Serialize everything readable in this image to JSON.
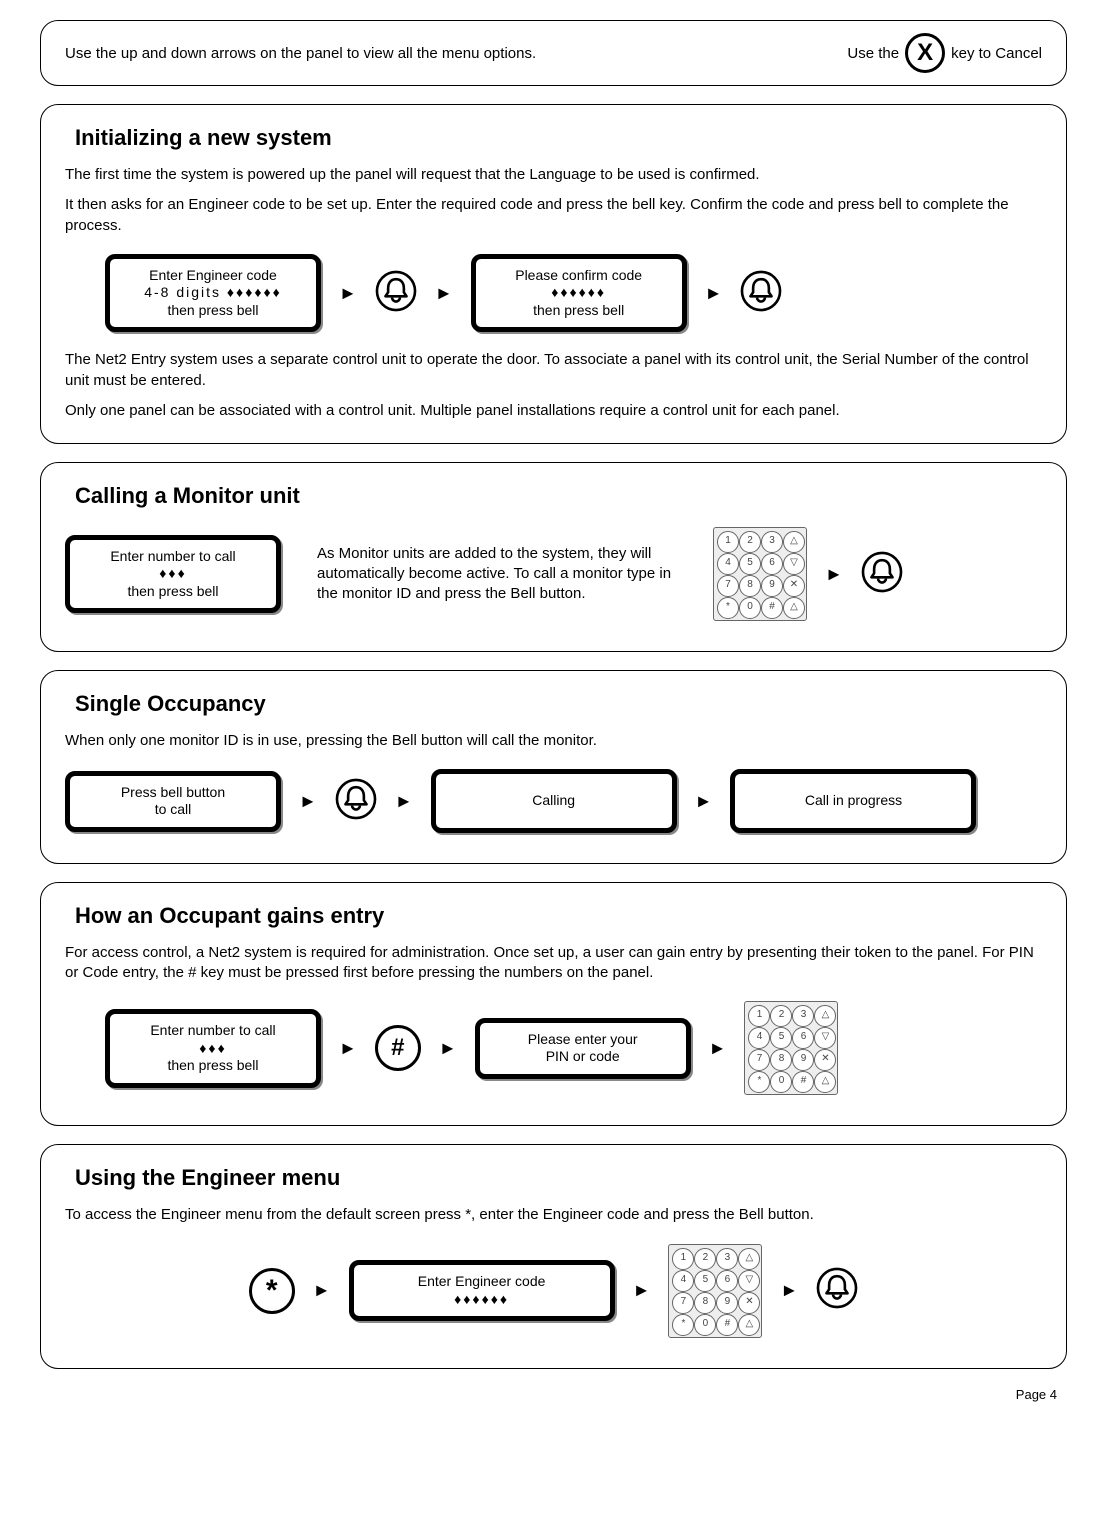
{
  "top": {
    "left": "Use the up and down arrows on the panel to view all the menu options.",
    "right_pre": "Use the",
    "right_post": "key to Cancel",
    "x": "X"
  },
  "sec1": {
    "title": "Initializing a new system",
    "p1": "The first time the system is powered up the panel will request that the Language to be used is confirmed.",
    "p2": "It then asks for an Engineer code to be set up. Enter the required code and press the bell key. Confirm the code and press bell to complete the process.",
    "lcd1_l1": "Enter Engineer code",
    "lcd1_l2": "4-8 digits  ♦♦♦♦♦♦",
    "lcd1_l3": "then press bell",
    "lcd2_l1": "Please confirm code",
    "lcd2_l2": "♦♦♦♦♦♦",
    "lcd2_l3": "then press bell",
    "p3": "The Net2 Entry system uses a separate control unit to operate the door. To associate a panel with its control unit, the Serial Number of the control unit must be entered.",
    "p4": "Only one panel can be associated with a control unit. Multiple panel installations require a control unit for each panel."
  },
  "sec2": {
    "title": "Calling a Monitor unit",
    "lcd_l1": "Enter number to call",
    "lcd_l2": "♦♦♦",
    "lcd_l3": "then press bell",
    "text": "As Monitor units are added to the system, they will automatically become active. To call a monitor type in the monitor ID and press the Bell button."
  },
  "sec3": {
    "title": "Single Occupancy",
    "p1": "When only one monitor ID is in use, pressing the Bell button will call the monitor.",
    "lcd1_l1": "Press bell button",
    "lcd1_l2": "to call",
    "lcd2": "Calling",
    "lcd3": "Call in progress"
  },
  "sec4": {
    "title": "How an Occupant gains entry",
    "p1": "For access control, a Net2 system is required for administration. Once set up, a user can gain entry by presenting their token to the panel. For PIN or Code entry, the # key must be pressed first before pressing the numbers on the panel.",
    "lcd1_l1": "Enter number to call",
    "lcd1_l2": "♦♦♦",
    "lcd1_l3": "then press bell",
    "hash": "#",
    "lcd2_l1": "Please enter your",
    "lcd2_l2": "PIN or code"
  },
  "sec5": {
    "title": "Using the Engineer menu",
    "p1": "To access the Engineer menu from the default screen press *, enter the Engineer code and press the Bell button.",
    "star": "*",
    "lcd_l1": "Enter Engineer code",
    "lcd_l2": "♦♦♦♦♦♦"
  },
  "keypad_labels": [
    "1",
    "2",
    "3",
    "△",
    "4",
    "5",
    "6",
    "▽",
    "7",
    "8",
    "9",
    "✕",
    "*",
    "0",
    "#",
    "△"
  ],
  "page": "Page 4"
}
